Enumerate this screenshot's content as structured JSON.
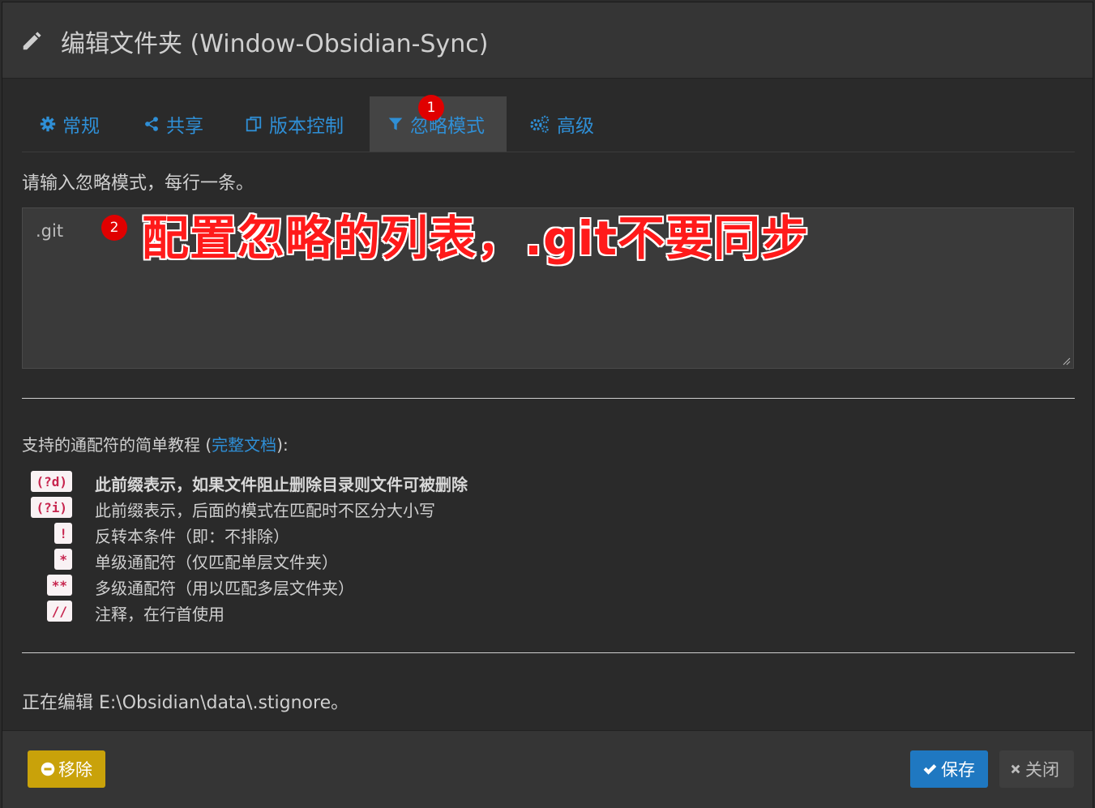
{
  "header": {
    "title": "编辑文件夹 (Window-Obsidian-Sync)"
  },
  "tabs": [
    {
      "label": "常规",
      "icon": "gear-icon"
    },
    {
      "label": "共享",
      "icon": "share-icon"
    },
    {
      "label": "版本控制",
      "icon": "copy-icon"
    },
    {
      "label": "忽略模式",
      "icon": "filter-icon",
      "active": true
    },
    {
      "label": "高级",
      "icon": "gears-icon"
    }
  ],
  "badges": {
    "one": "1",
    "two": "2"
  },
  "ignore": {
    "prompt": "请输入忽略模式，每行一条。",
    "value": ".git"
  },
  "annotation": "配置忽略的列表，.git不要同步",
  "wildcards": {
    "intro_prefix": "支持的通配符的简单教程 (",
    "intro_link": "完整文档",
    "intro_suffix": "):",
    "items": [
      {
        "code": "(?d)",
        "desc": "此前缀表示，如果文件阻止删除目录则文件可被删除"
      },
      {
        "code": "(?i)",
        "desc": "此前缀表示，后面的模式在匹配时不区分大小写"
      },
      {
        "code": "!",
        "desc": "反转本条件（即：不排除）"
      },
      {
        "code": "*",
        "desc": "单级通配符（仅匹配单层文件夹）"
      },
      {
        "code": "**",
        "desc": "多级通配符（用以匹配多层文件夹）"
      },
      {
        "code": "//",
        "desc": "注释，在行首使用"
      }
    ]
  },
  "editing": "正在编辑 E:\\Obsidian\\data\\.stignore。",
  "footer": {
    "remove_label": "移除",
    "save_label": "保存",
    "close_label": "关闭"
  },
  "colors": {
    "accent": "#2f8fd6",
    "remove": "#c9a20a",
    "save": "#1f78c1",
    "badge": "#e00000",
    "annotation": "#ff1a1a"
  }
}
